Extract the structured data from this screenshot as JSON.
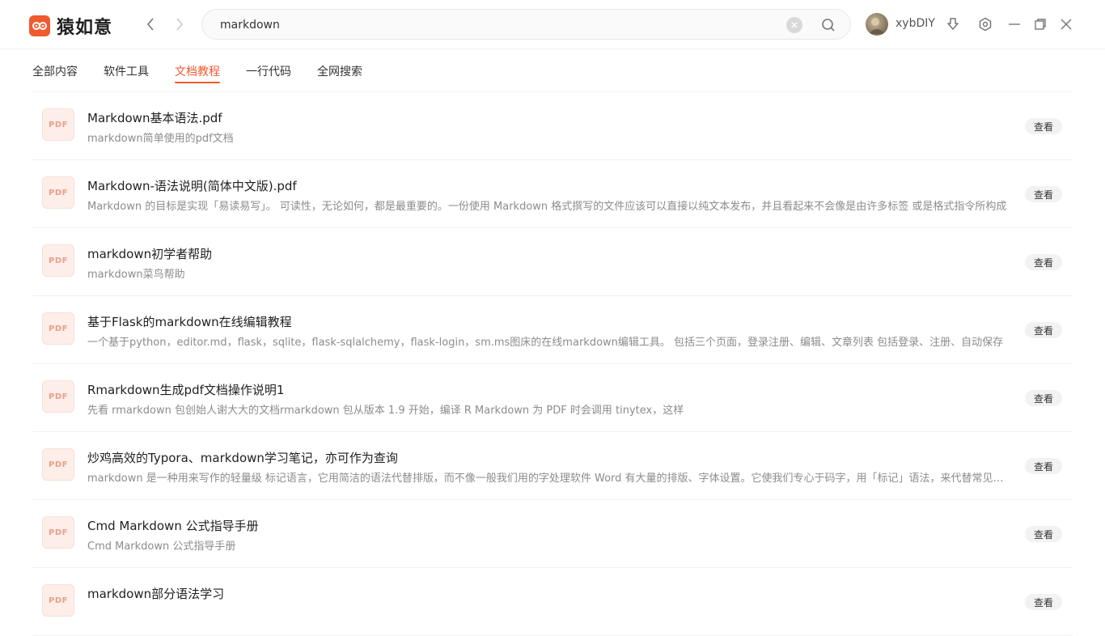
{
  "app": {
    "name": "猿如意",
    "brand_color": "#ef5a2e"
  },
  "search": {
    "value": "markdown"
  },
  "user": {
    "name": "xybDIY"
  },
  "tabs": [
    {
      "label": "全部内容",
      "active": false
    },
    {
      "label": "软件工具",
      "active": false
    },
    {
      "label": "文档教程",
      "active": true
    },
    {
      "label": "一行代码",
      "active": false
    },
    {
      "label": "全网搜索",
      "active": false
    }
  ],
  "results": [
    {
      "thumb": "PDF",
      "title": "Markdown基本语法.pdf",
      "desc": "markdown简单使用的pdf文档",
      "action": "查看"
    },
    {
      "thumb": "PDF",
      "title": "Markdown-语法说明(简体中文版).pdf",
      "desc": "Markdown 的目标是实现「易读易写」。 可读性，无论如何，都是最重要的。一份使用 Markdown 格式撰写的文件应该可以直接以纯文本发布，并且看起来不会像是由许多标签 或是格式指令所构成",
      "action": "查看"
    },
    {
      "thumb": "PDF",
      "title": "markdown初学者帮助",
      "desc": "markdown菜鸟帮助",
      "action": "查看"
    },
    {
      "thumb": "PDF",
      "title": "基于Flask的markdown在线编辑教程",
      "desc": "一个基于python，editor.md，flask，sqlite，flask-sqlalchemy，flask-login，sm.ms图床的在线markdown编辑工具。 包括三个页面，登录注册、编辑、文章列表 包括登录、注册、自动保存",
      "action": "查看"
    },
    {
      "thumb": "PDF",
      "title": "Rmarkdown生成pdf文档操作说明1",
      "desc": "先看 rmarkdown 包创始人谢大大的文档rmarkdown 包从版本 1.9 开始，编译 R Markdown 为 PDF 时会调用 tinytex，这样",
      "action": "查看"
    },
    {
      "thumb": "PDF",
      "title": "炒鸡高效的Typora、markdown学习笔记，亦可作为查询",
      "desc": "markdown 是一种用来写作的轻量级 标记语言，它用简洁的语法代替排版，而不像一般我们用的字处理软件 Word 有大量的排版、字体设置。它使我们专心于码字，用「标记」语法，来代替常见的排版格式",
      "action": "查看"
    },
    {
      "thumb": "PDF",
      "title": "Cmd Markdown 公式指导手册",
      "desc": "Cmd Markdown 公式指导手册",
      "action": "查看"
    },
    {
      "thumb": "PDF",
      "title": "markdown部分语法学习",
      "desc": "",
      "action": "查看"
    }
  ]
}
